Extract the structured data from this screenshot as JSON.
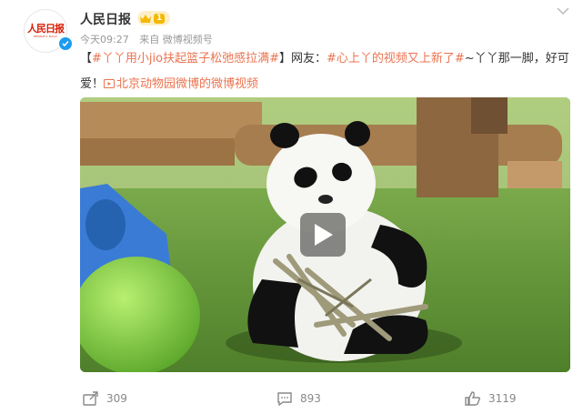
{
  "account": {
    "name": "人民日报",
    "logo_cn": "人民日报",
    "logo_en": "PEOPLE'S DAILY",
    "level": "1"
  },
  "meta": {
    "time": "今天09:27",
    "source": "来自 微博视频号"
  },
  "post": {
    "prefix": "【",
    "hashtag1": "#丫丫用小jio扶起篮子松弛感拉满#",
    "mid": "】网友：",
    "hashtag2": "#心上丫的视频又上新了#",
    "text": "~丫丫那一脚，好可爱！",
    "link": "北京动物园微博的微博视频"
  },
  "actions": {
    "repost": "309",
    "comment": "893",
    "like": "3119"
  },
  "colors": {
    "tag": "#eb7350",
    "verify": "#1d9bf0",
    "logo": "#d81e06"
  }
}
